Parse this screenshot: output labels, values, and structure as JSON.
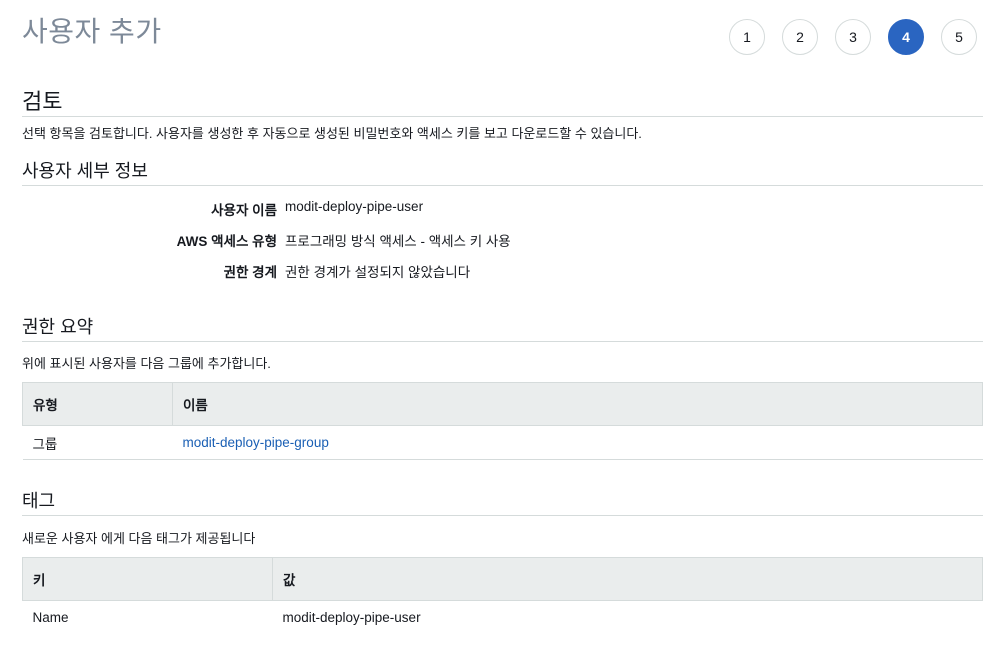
{
  "page": {
    "title": "사용자 추가"
  },
  "steps": [
    "1",
    "2",
    "3",
    "4",
    "5"
  ],
  "active_step": "4",
  "review": {
    "heading": "검토",
    "description": "선택 항목을 검토합니다. 사용자를 생성한 후 자동으로 생성된 비밀번호와 액세스 키를 보고 다운로드할 수 있습니다."
  },
  "user_details": {
    "heading": "사용자 세부 정보",
    "rows": [
      {
        "key": "사용자 이름",
        "value": "modit-deploy-pipe-user"
      },
      {
        "key": "AWS 액세스 유형",
        "value": "프로그래밍 방식 액세스 - 액세스 키 사용"
      },
      {
        "key": "권한 경계",
        "value": "권한 경계가 설정되지 않았습니다"
      }
    ]
  },
  "permissions": {
    "heading": "권한 요약",
    "description": "위에 표시된 사용자를 다음 그룹에 추가합니다.",
    "columns": [
      "유형",
      "이름"
    ],
    "rows": [
      {
        "type": "그룹",
        "name": "modit-deploy-pipe-group"
      }
    ]
  },
  "tags": {
    "heading": "태그",
    "description": "새로운 사용자 에게 다음 태그가 제공됩니다",
    "columns": [
      "키",
      "값"
    ],
    "rows": [
      {
        "key": "Name",
        "value": "modit-deploy-pipe-user"
      }
    ]
  }
}
